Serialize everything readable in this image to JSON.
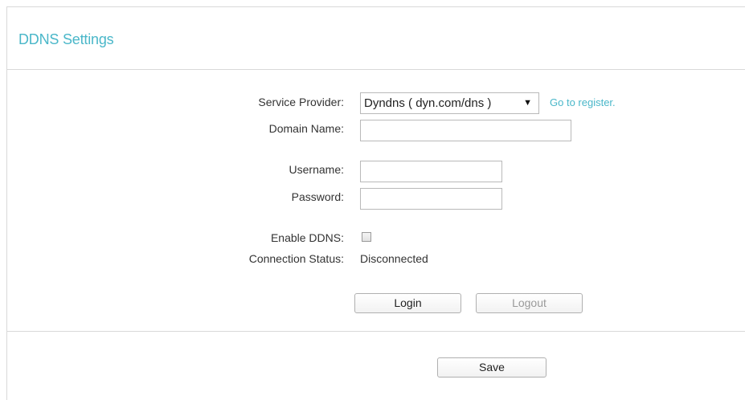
{
  "panel": {
    "title": "DDNS Settings"
  },
  "form": {
    "service_provider_label": "Service Provider:",
    "service_provider_value": "Dyndns ( dyn.com/dns )",
    "go_register_label": "Go to register.",
    "domain_name_label": "Domain Name:",
    "domain_name_value": "",
    "username_label": "Username:",
    "username_value": "",
    "password_label": "Password:",
    "password_value": "",
    "enable_ddns_label": "Enable DDNS:",
    "enable_ddns_checked": false,
    "connection_status_label": "Connection Status:",
    "connection_status_value": "Disconnected"
  },
  "buttons": {
    "login": "Login",
    "logout": "Logout",
    "save": "Save"
  },
  "colors": {
    "accent": "#4ab7c9"
  },
  "icons": {
    "dropdown_arrow": "dropdown-arrow-icon"
  }
}
